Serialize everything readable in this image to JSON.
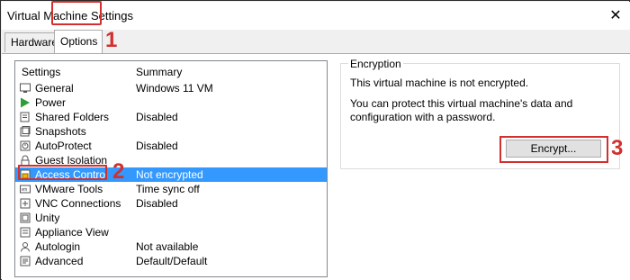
{
  "window": {
    "title": "Virtual Machine Settings",
    "close_glyph": "✕"
  },
  "tabs": [
    {
      "label": "Hardware"
    },
    {
      "label": "Options"
    }
  ],
  "list": {
    "headers": {
      "settings": "Settings",
      "summary": "Summary"
    },
    "rows": [
      {
        "label": "General",
        "summary": "Windows 11 VM",
        "icon": "monitor-icon"
      },
      {
        "label": "Power",
        "summary": "",
        "icon": "play-icon"
      },
      {
        "label": "Shared Folders",
        "summary": "Disabled",
        "icon": "folder-icon"
      },
      {
        "label": "Snapshots",
        "summary": "",
        "icon": "camera-icon"
      },
      {
        "label": "AutoProtect",
        "summary": "Disabled",
        "icon": "clock-icon"
      },
      {
        "label": "Guest Isolation",
        "summary": "",
        "icon": "lock-icon"
      },
      {
        "label": "Access Control",
        "summary": "Not encrypted",
        "icon": "key-icon",
        "selected": true
      },
      {
        "label": "VMware Tools",
        "summary": "Time sync off",
        "icon": "vm-icon"
      },
      {
        "label": "VNC Connections",
        "summary": "Disabled",
        "icon": "network-icon"
      },
      {
        "label": "Unity",
        "summary": "",
        "icon": "unity-icon"
      },
      {
        "label": "Appliance View",
        "summary": "",
        "icon": "appliance-icon"
      },
      {
        "label": "Autologin",
        "summary": "Not available",
        "icon": "user-icon"
      },
      {
        "label": "Advanced",
        "summary": "Default/Default",
        "icon": "advanced-icon"
      }
    ]
  },
  "encryption": {
    "title": "Encryption",
    "status": "This virtual machine is not encrypted.",
    "description": "You can protect this virtual machine's data and configuration with a password.",
    "button_label": "Encrypt..."
  },
  "annotations": {
    "step1": "1",
    "step2": "2",
    "step3": "3",
    "color": "#d32f2f"
  },
  "colors": {
    "selection": "#3399ff",
    "accent_red": "#d32f2f"
  }
}
